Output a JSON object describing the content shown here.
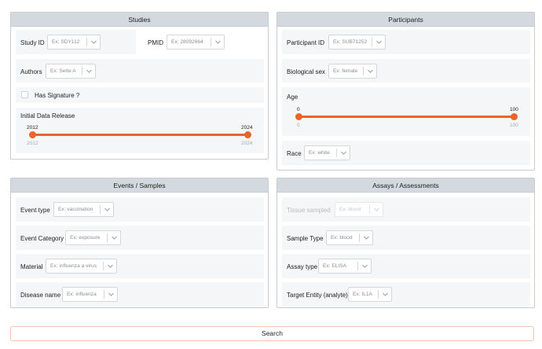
{
  "studies": {
    "title": "Studies",
    "study_id": {
      "label": "Study ID",
      "placeholder": "Ex: SDY112"
    },
    "pmid": {
      "label": "PMID",
      "placeholder": "Ex: 28092664"
    },
    "authors": {
      "label": "Authors",
      "placeholder": "Ex: Sette A"
    },
    "has_signature": {
      "label": "Has Signature ?"
    },
    "release": {
      "label": "Initial Data Release",
      "min": "2012",
      "max": "2024",
      "low": "2012",
      "high": "2024",
      "range": [
        2012,
        2024
      ],
      "selected": [
        2012,
        2024
      ]
    }
  },
  "participants": {
    "title": "Participants",
    "participant_id": {
      "label": "Participant ID",
      "placeholder": "Ex: SUB71252"
    },
    "sex": {
      "label": "Biological sex",
      "placeholder": "Ex: female"
    },
    "age": {
      "label": "Age",
      "min": "0",
      "max": "100",
      "low": "0",
      "high": "100",
      "range": [
        0,
        100
      ],
      "selected": [
        0,
        100
      ]
    },
    "race": {
      "label": "Race",
      "placeholder": "Ex: white"
    }
  },
  "events": {
    "title": "Events / Samples",
    "event_type": {
      "label": "Event type",
      "placeholder": "Ex: vaccination"
    },
    "event_category": {
      "label": "Event Category",
      "placeholder": "Ex: exposure"
    },
    "material": {
      "label": "Material",
      "placeholder": "Ex: influenza a virus"
    },
    "disease": {
      "label": "Disease name",
      "placeholder": "Ex: influenza"
    }
  },
  "assays": {
    "title": "Assays / Assessments",
    "tissue": {
      "label": "Tissue sampled",
      "placeholder": "Ex: blood"
    },
    "sample_type": {
      "label": "Sample Type",
      "placeholder": "Ex: blood"
    },
    "assay_type": {
      "label": "Assay type",
      "placeholder": "Ex: ELISA"
    },
    "target": {
      "label": "Target Entity (analyte)",
      "placeholder": "Ex: IL1A"
    }
  },
  "search": {
    "label": "Search"
  },
  "colors": {
    "accent": "#e8662a",
    "header_bg": "#d3d9de",
    "row_bg": "#f5f6f7"
  }
}
